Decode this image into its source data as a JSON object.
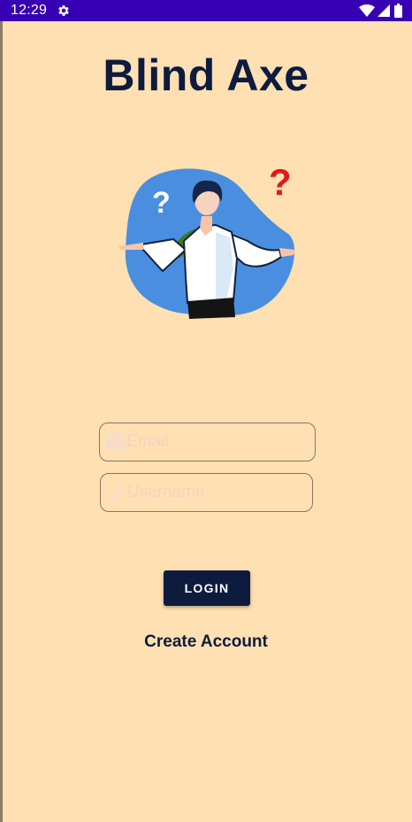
{
  "status_bar": {
    "time": "12:29",
    "icons": [
      "gear-icon",
      "wifi-icon",
      "signal-icon",
      "battery-icon"
    ],
    "background_color": "#3700b3"
  },
  "app": {
    "title": "Blind Axe",
    "background_color": "#ffe0b2",
    "accent_color": "#0d1b3e",
    "illustration": "confused-person-illustration"
  },
  "form": {
    "email": {
      "placeholder": "Email",
      "value": "",
      "icon": "email-icon"
    },
    "username": {
      "placeholder": "Username",
      "value": "",
      "icon": "pencil-icon"
    },
    "login_label": "LOGIN",
    "create_account_label": "Create Account"
  }
}
